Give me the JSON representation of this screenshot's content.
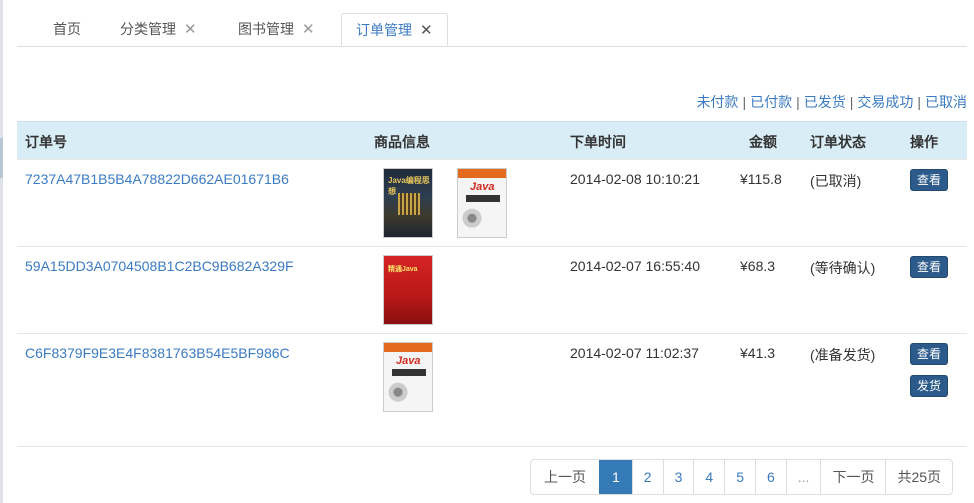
{
  "tabs": [
    {
      "label": "首页",
      "closable": false
    },
    {
      "label": "分类管理",
      "closable": true
    },
    {
      "label": "图书管理",
      "closable": true
    },
    {
      "label": "订单管理",
      "closable": true,
      "active": true
    }
  ],
  "close_glyph": "✕",
  "filters": [
    "未付款",
    "已付款",
    "已发货",
    "交易成功",
    "已取消"
  ],
  "filter_separator": "|",
  "table": {
    "headers": {
      "order_no": "订单号",
      "goods": "商品信息",
      "time": "下单时间",
      "amount": "金额",
      "status": "订单状态",
      "action": "操作"
    },
    "rows": [
      {
        "order_no": "7237A47B1B5B4A78822D662AE01671B6",
        "books": [
          "Java编程思想",
          "Java"
        ],
        "time": "2014-02-08 10:10:21",
        "amount": "¥115.8",
        "status": "(已取消)",
        "actions": [
          "查看"
        ]
      },
      {
        "order_no": "59A15DD3A0704508B1C2BC9B682A329F",
        "books": [
          "精通Java"
        ],
        "time": "2014-02-07 16:55:40",
        "amount": "¥68.3",
        "status": "(等待确认)",
        "actions": [
          "查看"
        ]
      },
      {
        "order_no": "C6F8379F9E3E4F8381763B54E5BF986C",
        "books": [
          "Java"
        ],
        "time": "2014-02-07 11:02:37",
        "amount": "¥41.3",
        "status": "(准备发货)",
        "actions": [
          "查看",
          "发货"
        ]
      }
    ]
  },
  "pagination": {
    "prev": "上一页",
    "pages": [
      "1",
      "2",
      "3",
      "4",
      "5",
      "6"
    ],
    "current": "1",
    "ellipsis": "...",
    "next": "下一页",
    "total": "共25页"
  },
  "colors": {
    "accent": "#3b7bc2",
    "header_bg": "#d9edf7",
    "button_bg": "#2c5a8a",
    "page_active": "#337ab7"
  }
}
